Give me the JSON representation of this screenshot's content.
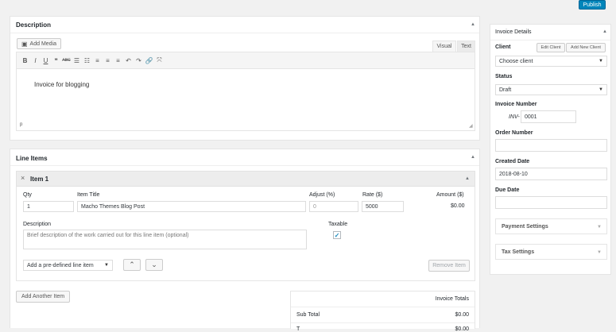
{
  "publish_label": "Publish",
  "description_box": {
    "title": "Description",
    "add_media_label": "Add Media",
    "tab_visual": "Visual",
    "tab_text": "Text",
    "content": "Invoice for blogging",
    "path": "p"
  },
  "toolbar": [
    {
      "name": "bold-icon",
      "glyph": "B"
    },
    {
      "name": "italic-icon",
      "glyph": "I"
    },
    {
      "name": "underline-icon",
      "glyph": "U"
    },
    {
      "name": "blockquote-icon",
      "glyph": "❝"
    },
    {
      "name": "strikethrough-icon",
      "glyph": "ABC"
    },
    {
      "name": "bullet-list-icon",
      "glyph": "☰"
    },
    {
      "name": "numbered-list-icon",
      "glyph": "☷"
    },
    {
      "name": "align-left-icon",
      "glyph": "≡"
    },
    {
      "name": "align-center-icon",
      "glyph": "≡"
    },
    {
      "name": "align-right-icon",
      "glyph": "≡"
    },
    {
      "name": "undo-icon",
      "glyph": "↶"
    },
    {
      "name": "redo-icon",
      "glyph": "↷"
    },
    {
      "name": "link-icon",
      "glyph": "🔗"
    },
    {
      "name": "fullscreen-icon",
      "glyph": "⤧"
    }
  ],
  "line_items": {
    "title": "Line Items",
    "item_title": "Item 1",
    "headers": {
      "qty": "Qty",
      "item_title": "Item Title",
      "adjust": "Adjust (%)",
      "rate": "Rate ($)",
      "amount": "Amount ($)"
    },
    "values": {
      "qty": "1",
      "item_title": "Macho Themes Blog Post",
      "adjust": "0",
      "rate": "5000",
      "amount": "$0.00"
    },
    "description_label": "Description",
    "description_placeholder": "Brief description of the work carried out for this line item (optional)",
    "taxable_label": "Taxable",
    "predefined_label": "Add a pre-defined line item",
    "remove_label": "Remove Item",
    "add_another_label": "Add Another Item"
  },
  "totals": {
    "title": "Invoice Totals",
    "sub_total_label": "Sub Total",
    "sub_total_value": "$0.00",
    "next_label": "T",
    "next_value": "$0.00"
  },
  "invoice_details": {
    "title": "Invoice Details",
    "client_label": "Client",
    "edit_client": "Edit Client",
    "add_client": "Add New Client",
    "client_value": "Choose client",
    "status_label": "Status",
    "status_value": "Draft",
    "number_label": "Invoice Number",
    "number_prefix": "INV-",
    "number_value": "0001",
    "order_label": "Order Number",
    "order_value": "",
    "created_label": "Created Date",
    "created_value": "2018-08-10",
    "due_label": "Due Date",
    "due_value": "",
    "payment_settings": "Payment Settings",
    "tax_settings": "Tax Settings"
  },
  "colors": {
    "primary": "#0085ba",
    "border": "#e5e5e5",
    "checkbox": "#1e8cbe"
  }
}
